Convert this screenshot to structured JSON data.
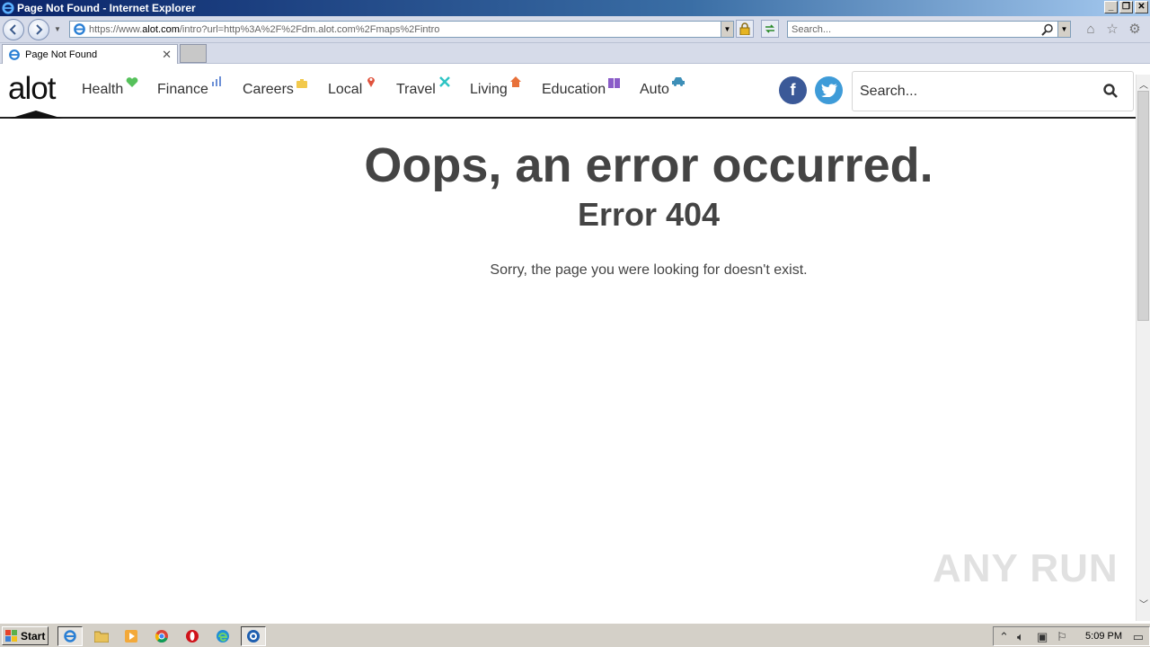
{
  "window": {
    "title": "Page Not Found - Internet Explorer",
    "minimize": "_",
    "restore": "❐",
    "close": "✕"
  },
  "toolbar": {
    "url_prefix": "https://www.",
    "url_domain": "alot.com",
    "url_rest": "/intro?url=http%3A%2F%2Fdm.alot.com%2Fmaps%2Fintro",
    "search_placeholder": "Search..."
  },
  "tabs": [
    {
      "label": "Page Not Found",
      "close": "✕"
    }
  ],
  "site": {
    "logo": "alot",
    "nav": [
      {
        "label": "Health",
        "icon": "heart-icon",
        "glyph": "♥",
        "color": "#56c15b"
      },
      {
        "label": "Finance",
        "icon": "bar-chart-icon",
        "glyph": "▮",
        "color": "#6b8fd6"
      },
      {
        "label": "Careers",
        "icon": "briefcase-icon",
        "glyph": "■",
        "color": "#f2c94c"
      },
      {
        "label": "Local",
        "icon": "map-pin-icon",
        "glyph": "●",
        "color": "#e0533d"
      },
      {
        "label": "Travel",
        "icon": "plane-icon",
        "glyph": "✕",
        "color": "#2ec4c4"
      },
      {
        "label": "Living",
        "icon": "house-icon",
        "glyph": "▲",
        "color": "#e8713a"
      },
      {
        "label": "Education",
        "icon": "book-icon",
        "glyph": "■",
        "color": "#8a5cc8"
      },
      {
        "label": "Auto",
        "icon": "car-icon",
        "glyph": "▬",
        "color": "#3d8fb8"
      }
    ],
    "facebook": "f",
    "twitter": "t",
    "search_placeholder": "Search..."
  },
  "error": {
    "title": "Oops, an error occurred.",
    "code": "Error 404",
    "message": "Sorry, the page you were looking for doesn't exist."
  },
  "watermark": "ANY RUN",
  "taskbar": {
    "start": "Start",
    "clock": "5:09 PM"
  }
}
